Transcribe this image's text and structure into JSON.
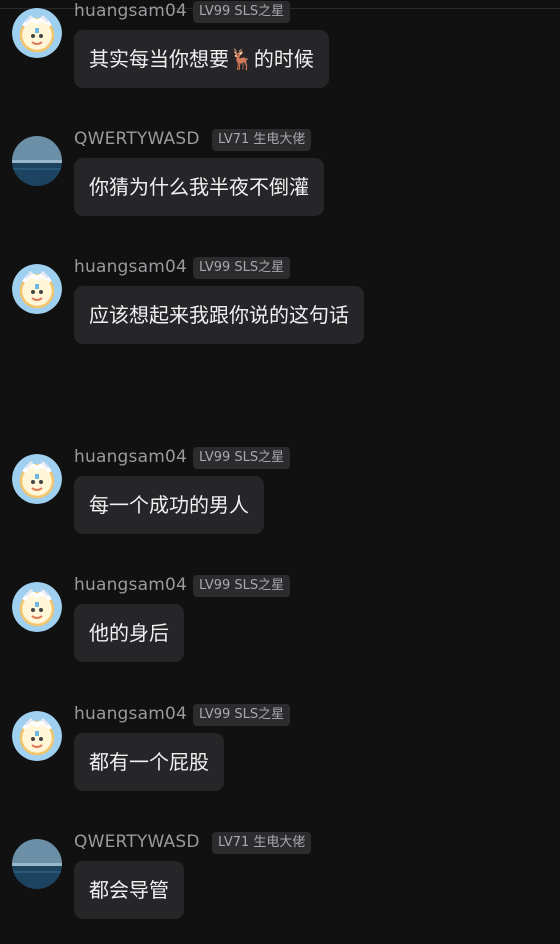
{
  "users": {
    "huang": {
      "name": "huangsam04",
      "badge": "LV99 SLS之星"
    },
    "qwerty": {
      "name": "QWERTYWASD",
      "badge": "LV71 生电大佬"
    }
  },
  "messages": [
    {
      "user": "huangsam04",
      "badge": "LV99 SLS之星",
      "text": "其实每当你想要🦌的时候"
    },
    {
      "user": "QWERTYWASD",
      "badge": "LV71 生电大佬",
      "text": "你猜为什么我半夜不倒灌"
    },
    {
      "user": "huangsam04",
      "badge": "LV99 SLS之星",
      "text": "应该想起来我跟你说的这句话"
    },
    {
      "user": "huangsam04",
      "badge": "LV99 SLS之星",
      "text": "每一个成功的男人"
    },
    {
      "user": "huangsam04",
      "badge": "LV99 SLS之星",
      "text": "他的身后"
    },
    {
      "user": "huangsam04",
      "badge": "LV99 SLS之星",
      "text": "都有一个屁股"
    },
    {
      "user": "QWERTYWASD",
      "badge": "LV71 生电大佬",
      "text": "都会导管"
    }
  ],
  "colors": {
    "background": "#111112",
    "bubble": "#262628",
    "badge_bg": "#2c2c2e",
    "name_text": "#9a9a9e",
    "message_text": "#f0f0f2"
  },
  "icons": {
    "huangsam04": "cartoon-avatar-icon",
    "QWERTYWASD": "sea-horizon-avatar-icon"
  }
}
